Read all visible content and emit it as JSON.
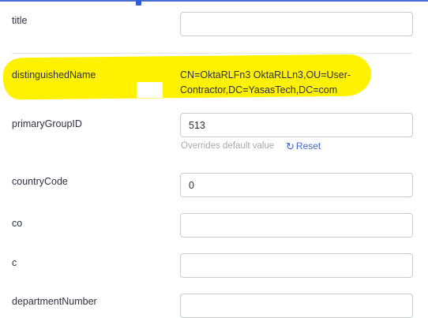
{
  "fields": [
    {
      "label": "title",
      "value": "",
      "placeholder": ""
    },
    {
      "label": "distinguishedName",
      "value": "CN=OktaRLFn3 OktaRLLn3,OU=User-Contractor,DC=YasasTech,DC=com"
    },
    {
      "label": "primaryGroupID",
      "value": "513",
      "hint": "Overrides default value",
      "reset_label": "Reset"
    },
    {
      "label": "countryCode",
      "value": "0"
    },
    {
      "label": "co",
      "value": ""
    },
    {
      "label": "c",
      "value": ""
    },
    {
      "label": "departmentNumber",
      "value": ""
    }
  ],
  "icons": {
    "reset": "reset-icon",
    "top_handle": "resize-handle-icon"
  },
  "colors": {
    "highlight": "#fff200",
    "link": "#3f66c9",
    "top_rule": "#4a6fd3"
  }
}
